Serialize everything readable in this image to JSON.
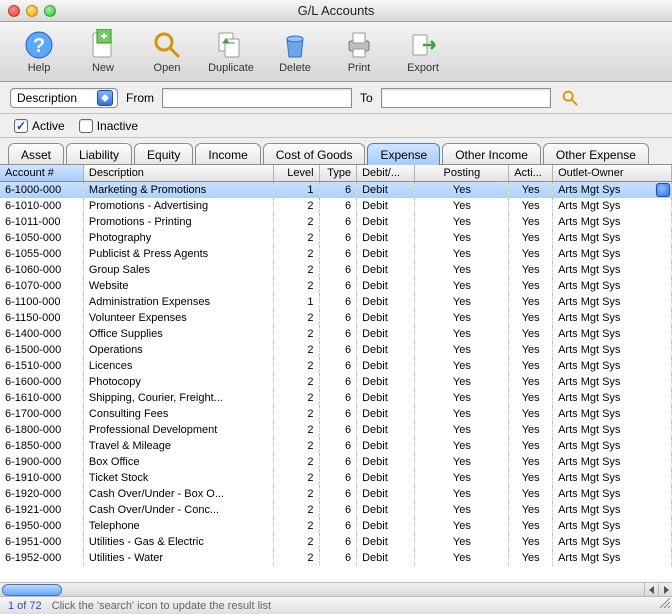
{
  "window": {
    "title": "G/L Accounts"
  },
  "toolbar": {
    "help": "Help",
    "new": "New",
    "open": "Open",
    "duplicate": "Duplicate",
    "delete": "Delete",
    "print": "Print",
    "export": "Export"
  },
  "filter": {
    "combo_label": "Description",
    "from_label": "From",
    "to_label": "To",
    "from_value": "",
    "to_value": ""
  },
  "checks": {
    "active_label": "Active",
    "inactive_label": "Inactive",
    "active_checked": true,
    "inactive_checked": false
  },
  "tabs": {
    "items": [
      "Asset",
      "Liability",
      "Equity",
      "Income",
      "Cost of Goods",
      "Expense",
      "Other Income",
      "Other Expense"
    ],
    "active_index": 5
  },
  "columns": {
    "account": "Account #",
    "description": "Description",
    "level": "Level",
    "type": "Type",
    "debitcredit": "Debit/...",
    "posting": "Posting",
    "active": "Acti...",
    "outlet": "Outlet-Owner"
  },
  "rows": [
    {
      "acct": "6-1000-000",
      "desc": "Marketing & Promotions",
      "level": 1,
      "type": 6,
      "dc": "Debit",
      "post": "Yes",
      "active": "Yes",
      "outlet": "Arts Mgt Sys",
      "selected": true
    },
    {
      "acct": "6-1010-000",
      "desc": "Promotions - Advertising",
      "level": 2,
      "type": 6,
      "dc": "Debit",
      "post": "Yes",
      "active": "Yes",
      "outlet": "Arts Mgt Sys"
    },
    {
      "acct": "6-1011-000",
      "desc": "Promotions - Printing",
      "level": 2,
      "type": 6,
      "dc": "Debit",
      "post": "Yes",
      "active": "Yes",
      "outlet": "Arts Mgt Sys"
    },
    {
      "acct": "6-1050-000",
      "desc": "Photography",
      "level": 2,
      "type": 6,
      "dc": "Debit",
      "post": "Yes",
      "active": "Yes",
      "outlet": "Arts Mgt Sys"
    },
    {
      "acct": "6-1055-000",
      "desc": "Publicist & Press Agents",
      "level": 2,
      "type": 6,
      "dc": "Debit",
      "post": "Yes",
      "active": "Yes",
      "outlet": "Arts Mgt Sys"
    },
    {
      "acct": "6-1060-000",
      "desc": "Group Sales",
      "level": 2,
      "type": 6,
      "dc": "Debit",
      "post": "Yes",
      "active": "Yes",
      "outlet": "Arts Mgt Sys"
    },
    {
      "acct": "6-1070-000",
      "desc": "Website",
      "level": 2,
      "type": 6,
      "dc": "Debit",
      "post": "Yes",
      "active": "Yes",
      "outlet": "Arts Mgt Sys"
    },
    {
      "acct": "6-1100-000",
      "desc": "Administration Expenses",
      "level": 1,
      "type": 6,
      "dc": "Debit",
      "post": "Yes",
      "active": "Yes",
      "outlet": "Arts Mgt Sys"
    },
    {
      "acct": "6-1150-000",
      "desc": "Volunteer Expenses",
      "level": 2,
      "type": 6,
      "dc": "Debit",
      "post": "Yes",
      "active": "Yes",
      "outlet": "Arts Mgt Sys"
    },
    {
      "acct": "6-1400-000",
      "desc": "Office Supplies",
      "level": 2,
      "type": 6,
      "dc": "Debit",
      "post": "Yes",
      "active": "Yes",
      "outlet": "Arts Mgt Sys"
    },
    {
      "acct": "6-1500-000",
      "desc": "Operations",
      "level": 2,
      "type": 6,
      "dc": "Debit",
      "post": "Yes",
      "active": "Yes",
      "outlet": "Arts Mgt Sys"
    },
    {
      "acct": "6-1510-000",
      "desc": "Licences",
      "level": 2,
      "type": 6,
      "dc": "Debit",
      "post": "Yes",
      "active": "Yes",
      "outlet": "Arts Mgt Sys"
    },
    {
      "acct": "6-1600-000",
      "desc": "Photocopy",
      "level": 2,
      "type": 6,
      "dc": "Debit",
      "post": "Yes",
      "active": "Yes",
      "outlet": "Arts Mgt Sys"
    },
    {
      "acct": "6-1610-000",
      "desc": "Shipping, Courier, Freight...",
      "level": 2,
      "type": 6,
      "dc": "Debit",
      "post": "Yes",
      "active": "Yes",
      "outlet": "Arts Mgt Sys"
    },
    {
      "acct": "6-1700-000",
      "desc": "Consulting Fees",
      "level": 2,
      "type": 6,
      "dc": "Debit",
      "post": "Yes",
      "active": "Yes",
      "outlet": "Arts Mgt Sys"
    },
    {
      "acct": "6-1800-000",
      "desc": "Professional Development",
      "level": 2,
      "type": 6,
      "dc": "Debit",
      "post": "Yes",
      "active": "Yes",
      "outlet": "Arts Mgt Sys"
    },
    {
      "acct": "6-1850-000",
      "desc": "Travel & Mileage",
      "level": 2,
      "type": 6,
      "dc": "Debit",
      "post": "Yes",
      "active": "Yes",
      "outlet": "Arts Mgt Sys"
    },
    {
      "acct": "6-1900-000",
      "desc": "Box Office",
      "level": 2,
      "type": 6,
      "dc": "Debit",
      "post": "Yes",
      "active": "Yes",
      "outlet": "Arts Mgt Sys"
    },
    {
      "acct": "6-1910-000",
      "desc": "Ticket Stock",
      "level": 2,
      "type": 6,
      "dc": "Debit",
      "post": "Yes",
      "active": "Yes",
      "outlet": "Arts Mgt Sys"
    },
    {
      "acct": "6-1920-000",
      "desc": "Cash Over/Under - Box O...",
      "level": 2,
      "type": 6,
      "dc": "Debit",
      "post": "Yes",
      "active": "Yes",
      "outlet": "Arts Mgt Sys"
    },
    {
      "acct": "6-1921-000",
      "desc": "Cash Over/Under - Conc...",
      "level": 2,
      "type": 6,
      "dc": "Debit",
      "post": "Yes",
      "active": "Yes",
      "outlet": "Arts Mgt Sys"
    },
    {
      "acct": "6-1950-000",
      "desc": "Telephone",
      "level": 2,
      "type": 6,
      "dc": "Debit",
      "post": "Yes",
      "active": "Yes",
      "outlet": "Arts Mgt Sys"
    },
    {
      "acct": "6-1951-000",
      "desc": "Utilities - Gas & Electric",
      "level": 2,
      "type": 6,
      "dc": "Debit",
      "post": "Yes",
      "active": "Yes",
      "outlet": "Arts Mgt Sys"
    },
    {
      "acct": "6-1952-000",
      "desc": "Utilities - Water",
      "level": 2,
      "type": 6,
      "dc": "Debit",
      "post": "Yes",
      "active": "Yes",
      "outlet": "Arts Mgt Sys"
    }
  ],
  "status": {
    "count": "1 of 72",
    "hint": "Click the 'search' icon to update the result list"
  }
}
